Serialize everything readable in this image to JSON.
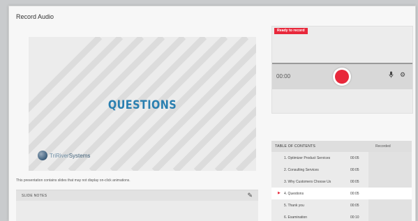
{
  "window": {
    "title": "Record Audio"
  },
  "slide": {
    "title": "QUESTIONS",
    "logo_prefix": "TriRiver",
    "logo_suffix": "Systems"
  },
  "notice": "This presentation contains slides that may not display on-click animations.",
  "notes": {
    "label": "SLIDE NOTES",
    "edit_icon": "pencil-icon"
  },
  "recorder": {
    "status": "Ready to record",
    "time": "00:00",
    "icons": [
      "record-icon",
      "microphone-icon",
      "gear-icon"
    ],
    "accent": "#e8283b"
  },
  "toc": {
    "heading": "TABLE OF CONTENTS",
    "recorded_heading": "Recorded",
    "rows": [
      {
        "name": "1. Optimizer Product Services",
        "duration": "00:05",
        "current": false
      },
      {
        "name": "2. Consulting Services",
        "duration": "00:05",
        "current": false
      },
      {
        "name": "3. Why Customers Choose Us",
        "duration": "00:05",
        "current": false
      },
      {
        "name": "4. Questions",
        "duration": "00:05",
        "current": true
      },
      {
        "name": "5. Thank you",
        "duration": "00:05",
        "current": false
      },
      {
        "name": "6. Examination",
        "duration": "00:10",
        "current": false
      }
    ]
  }
}
